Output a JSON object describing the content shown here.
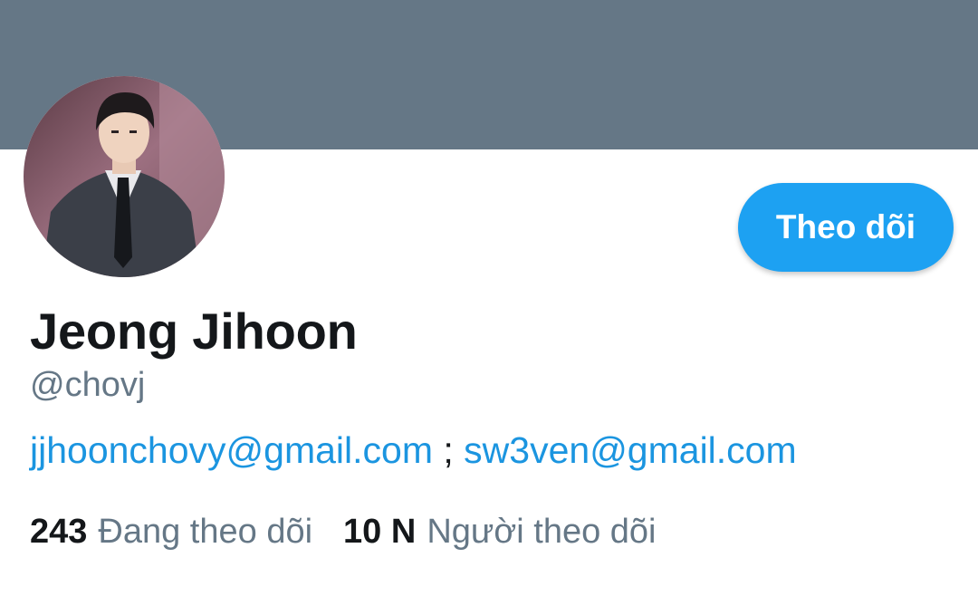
{
  "profile": {
    "banner_color": "#657786",
    "avatar_label": "profile-photo",
    "name": "Jeong Jihoon",
    "handle": "@chovj",
    "follow_label": "Theo dõi",
    "accent_color": "#1da1f2",
    "bio": {
      "link1": "jjhoonchovy@gmail.com",
      "separator": " ; ",
      "link2": "sw3ven@gmail.com"
    },
    "stats": {
      "following_count": "243",
      "following_label": "Đang theo dõi",
      "followers_count": "10 N",
      "followers_label": "Người theo dõi"
    }
  }
}
